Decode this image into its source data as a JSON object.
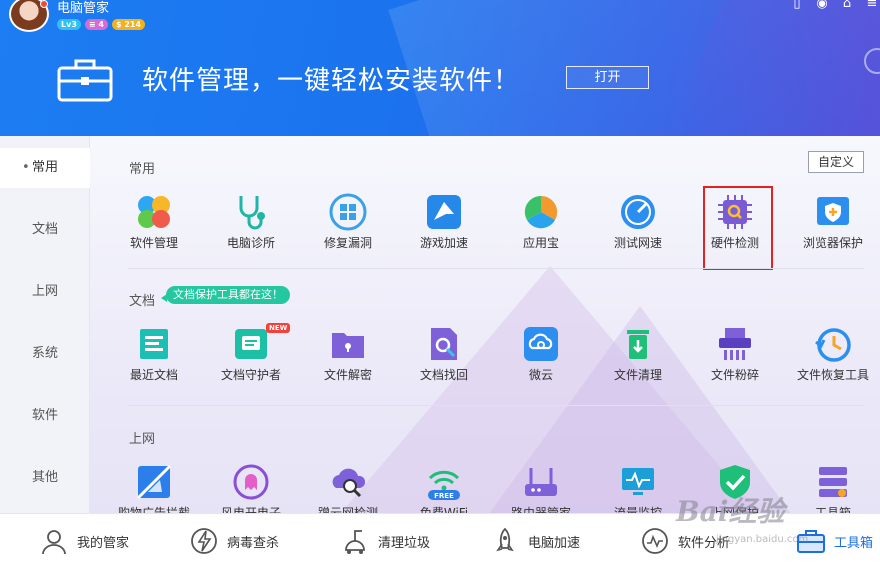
{
  "header": {
    "app_title": "电脑管家",
    "level_badge": "Lv3",
    "vip_badge": "4",
    "coin_badge": "214",
    "banner_text": "软件管理，一键轻松安装软件！",
    "open_button": "打开"
  },
  "sidebar": {
    "items": [
      {
        "label": "常用",
        "active": true
      },
      {
        "label": "文档"
      },
      {
        "label": "上网"
      },
      {
        "label": "系统"
      },
      {
        "label": "软件"
      },
      {
        "label": "其他"
      }
    ]
  },
  "main": {
    "custom_button": "自定义",
    "sections": [
      {
        "title": "常用",
        "tools": [
          "软件管理",
          "电脑诊所",
          "修复漏洞",
          "游戏加速",
          "应用宝",
          "测试网速",
          "硬件检测",
          "浏览器保护"
        ]
      },
      {
        "title": "文档",
        "tip": "文档保护工具都在这！",
        "tools": [
          "最近文档",
          "文档守护者",
          "文件解密",
          "文档找回",
          "微云",
          "文件清理",
          "文件粉碎",
          "文件恢复工具"
        ],
        "new_tag": "NEW"
      },
      {
        "title": "上网",
        "tools": [
          "购物广告拦截",
          "风电开电子",
          "蹭云网检测",
          "免费WiFi",
          "路由器管家",
          "流量监控",
          "上网保护",
          "工具箱"
        ],
        "free_tag": "FREE"
      }
    ],
    "highlighted_tool": "硬件检测"
  },
  "bottom_nav": [
    {
      "label": "我的管家"
    },
    {
      "label": "病毒查杀"
    },
    {
      "label": "清理垃圾"
    },
    {
      "label": "电脑加速"
    },
    {
      "label": "软件分析"
    },
    {
      "label": "工具箱",
      "active": true
    }
  ],
  "watermark": {
    "text": "Bai经验",
    "url": "jingyan.baidu.com"
  },
  "colors": {
    "brand_blue": "#1d7df2",
    "accent_green": "#24c7a0",
    "highlight_red": "#e52222"
  }
}
